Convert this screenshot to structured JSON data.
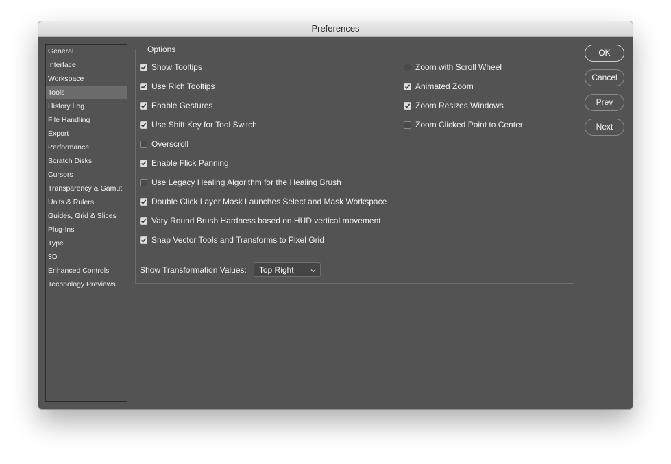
{
  "window": {
    "title": "Preferences"
  },
  "sidebar": {
    "items": [
      {
        "label": "General",
        "selected": false
      },
      {
        "label": "Interface",
        "selected": false
      },
      {
        "label": "Workspace",
        "selected": false
      },
      {
        "label": "Tools",
        "selected": true
      },
      {
        "label": "History Log",
        "selected": false
      },
      {
        "label": "File Handling",
        "selected": false
      },
      {
        "label": "Export",
        "selected": false
      },
      {
        "label": "Performance",
        "selected": false
      },
      {
        "label": "Scratch Disks",
        "selected": false
      },
      {
        "label": "Cursors",
        "selected": false
      },
      {
        "label": "Transparency & Gamut",
        "selected": false
      },
      {
        "label": "Units & Rulers",
        "selected": false
      },
      {
        "label": "Guides, Grid & Slices",
        "selected": false
      },
      {
        "label": "Plug-Ins",
        "selected": false
      },
      {
        "label": "Type",
        "selected": false
      },
      {
        "label": "3D",
        "selected": false
      },
      {
        "label": "Enhanced Controls",
        "selected": false
      },
      {
        "label": "Technology Previews",
        "selected": false
      }
    ]
  },
  "options": {
    "legend": "Options",
    "left_checkboxes": [
      {
        "label": "Show Tooltips",
        "checked": true
      },
      {
        "label": "Use Rich Tooltips",
        "checked": true
      },
      {
        "label": "Enable Gestures",
        "checked": true
      },
      {
        "label": "Use Shift Key for Tool Switch",
        "checked": true
      },
      {
        "label": "Overscroll",
        "checked": false
      },
      {
        "label": "Enable Flick Panning",
        "checked": true
      },
      {
        "label": "Use Legacy Healing Algorithm for the Healing Brush",
        "checked": false
      },
      {
        "label": "Double Click Layer Mask Launches Select and Mask Workspace",
        "checked": true
      },
      {
        "label": "Vary Round Brush Hardness based on HUD vertical movement",
        "checked": true
      },
      {
        "label": "Snap Vector Tools and Transforms to Pixel Grid",
        "checked": true
      }
    ],
    "right_checkboxes": [
      {
        "label": "Zoom with Scroll Wheel",
        "checked": false
      },
      {
        "label": "Animated Zoom",
        "checked": true
      },
      {
        "label": "Zoom Resizes Windows",
        "checked": true
      },
      {
        "label": "Zoom Clicked Point to Center",
        "checked": false
      }
    ],
    "transformation": {
      "label": "Show Transformation Values:",
      "selected": "Top Right"
    }
  },
  "buttons": {
    "ok": "OK",
    "cancel": "Cancel",
    "prev": "Prev",
    "next": "Next"
  },
  "icons": {
    "checkmark": "check-icon",
    "dropdown": "chevron-down-icon"
  }
}
